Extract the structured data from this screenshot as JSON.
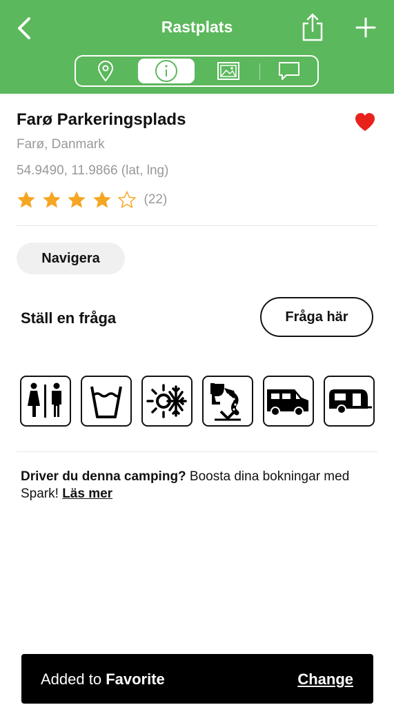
{
  "header": {
    "title": "Rastplats",
    "background_color": "#5cb85c",
    "tabs": [
      {
        "icon": "map-pin-icon",
        "active": false
      },
      {
        "icon": "info-icon",
        "active": true
      },
      {
        "icon": "image-icon",
        "active": false
      },
      {
        "icon": "comment-icon",
        "active": false
      }
    ]
  },
  "place": {
    "name": "Farø Parkeringsplads",
    "location": "Farø, Danmark",
    "coordinates": "54.9490, 11.9866 (lat, lng)",
    "rating": 4,
    "rating_max": 5,
    "review_count": "(22)",
    "favorite": true
  },
  "actions": {
    "navigate_label": "Navigera",
    "ask_label": "Ställ en fråga",
    "ask_button": "Fråga här"
  },
  "amenities": [
    {
      "icon": "toilets-icon"
    },
    {
      "icon": "drinking-water-icon"
    },
    {
      "icon": "winter-summer-icon"
    },
    {
      "icon": "chemical-toilet-disposal-icon"
    },
    {
      "icon": "motorhome-icon"
    },
    {
      "icon": "caravan-icon"
    }
  ],
  "promo": {
    "bold": "Driver du denna camping?",
    "text": " Boosta dina bokningar med Spark! ",
    "link": "Läs mer"
  },
  "toast": {
    "prefix": "Added to ",
    "emphasis": "Favorite",
    "action": "Change"
  },
  "colors": {
    "accent_green": "#5cb85c",
    "star": "#f5a623",
    "heart": "#e8221b",
    "muted_text": "#999999"
  }
}
